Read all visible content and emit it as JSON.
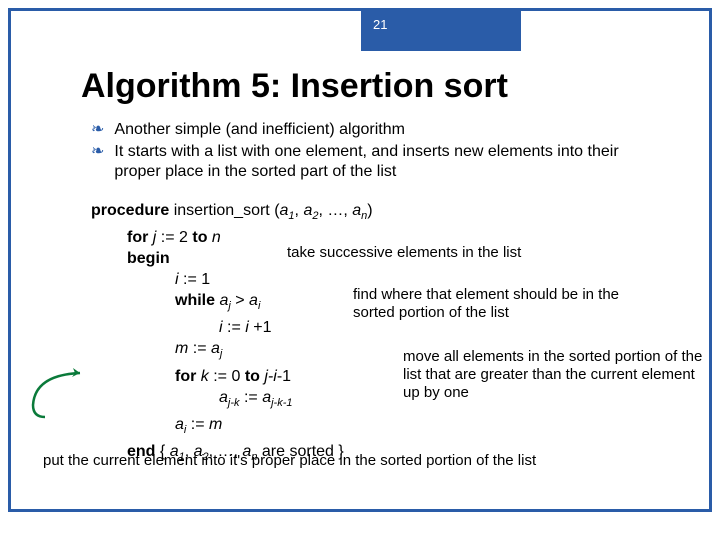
{
  "page_number": "21",
  "title": "Algorithm 5: Insertion sort",
  "bullets": [
    "Another simple (and inefficient) algorithm",
    "It starts with a list with one element, and inserts new elements into their proper place in the sorted part of the list"
  ],
  "code": {
    "l1a": "procedure",
    "l1b": " insertion_sort (",
    "l1c": "a",
    "l1c_s": "1",
    "l1d": ", ",
    "l1e": "a",
    "l1e_s": "2",
    "l1f": ", …, ",
    "l1g": "a",
    "l1g_s": "n",
    "l1h": ")",
    "l2a": "for",
    "l2b": " j",
    "l2c": " := 2 ",
    "l2d": "to",
    "l2e": " n",
    "l3": "begin",
    "l4a": "i",
    "l4b": " := 1",
    "l5a": "while",
    "l5b": " a",
    "l5b_s": "j",
    "l5c": " > ",
    "l5d": "a",
    "l5d_s": "i",
    "l6a": "i",
    "l6b": " := ",
    "l6c": "i",
    "l6d": " +1",
    "l7a": "m",
    "l7b": " := ",
    "l7c": "a",
    "l7c_s": "j",
    "l8a": "for",
    "l8b": " k",
    "l8c": " := 0 ",
    "l8d": "to",
    "l8e": " j-i",
    "l8f": "-1",
    "l9a": "a",
    "l9a_s": "j-k",
    "l9b": " := ",
    "l9c": "a",
    "l9c_s": "j-k-1",
    "l10a": "a",
    "l10a_s": "i",
    "l10b": " := ",
    "l10c": "m",
    "l11a": "end",
    "l11b": " { ",
    "l11c": "a",
    "l11c_s": "1",
    "l11d": ", ",
    "l11e": "a",
    "l11e_s": "2",
    "l11f": ", …, ",
    "l11g": "a",
    "l11g_s": "n",
    "l11h": " are sorted }"
  },
  "annotations": {
    "a1": "take successive elements in the list",
    "a2": "find where that element should be in the sorted portion of the list",
    "a3": "move all elements in the sorted portion of the list that are greater than the current element up by one"
  },
  "footnote": "put the current element into it's proper place in the sorted portion of the list"
}
